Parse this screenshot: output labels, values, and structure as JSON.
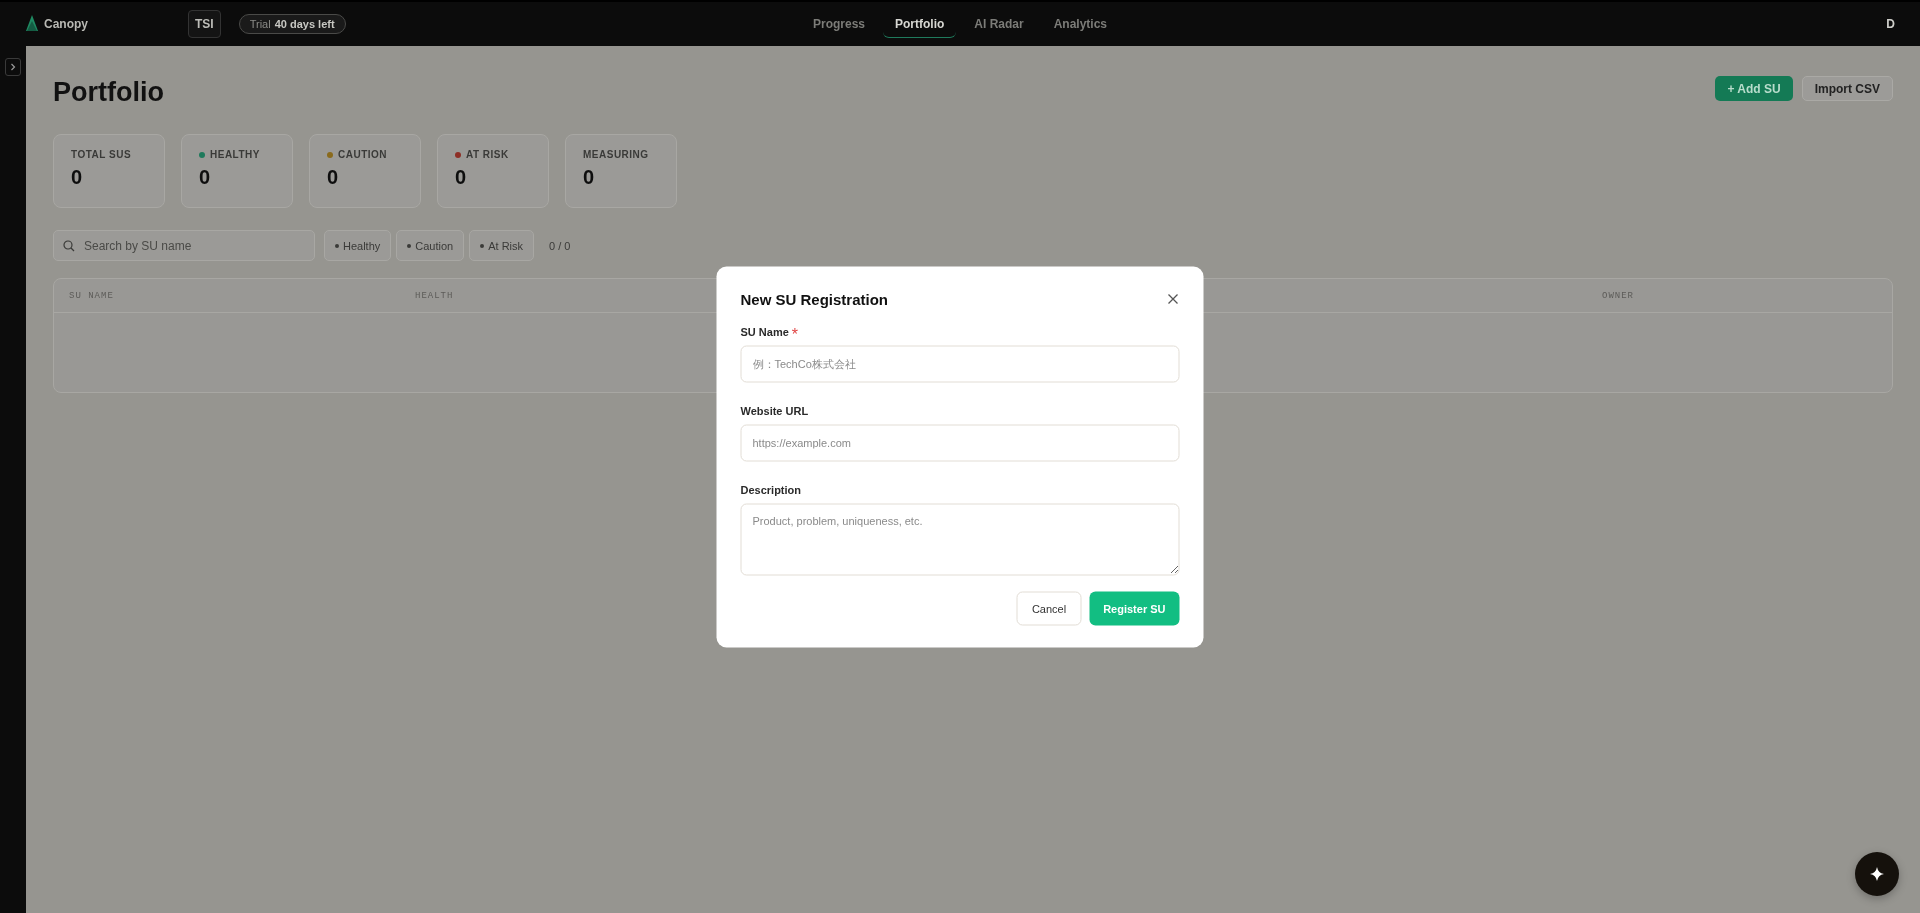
{
  "topbar": {
    "brand": "Canopy",
    "workspace": "TSI",
    "trial": {
      "label": "Trial",
      "value": "40 days left"
    },
    "nav": [
      {
        "label": "Progress",
        "selected": false
      },
      {
        "label": "Portfolio",
        "selected": true
      },
      {
        "label": "AI Radar",
        "selected": false
      },
      {
        "label": "Analytics",
        "selected": false
      }
    ],
    "user": "D"
  },
  "page": {
    "title": "Portfolio",
    "actions": [
      {
        "label": "+ Add SU",
        "kind": "primary"
      },
      {
        "label": "Import CSV",
        "kind": "secondary"
      }
    ],
    "stats": [
      {
        "label": "TOTAL SUS",
        "value": "0"
      },
      {
        "label": "HEALTHY",
        "value": "0",
        "color": "#1f7a5c"
      },
      {
        "label": "CAUTION",
        "value": "0",
        "color": "#8a6a1c"
      },
      {
        "label": "AT RISK",
        "value": "0",
        "color": "#8e2f26"
      },
      {
        "label": "MEASURING",
        "value": "0"
      }
    ],
    "search": {
      "placeholder": "Search by SU name"
    },
    "filters": [
      {
        "label": "Healthy"
      },
      {
        "label": "Caution"
      },
      {
        "label": "At Risk"
      }
    ],
    "count": "0 / 0",
    "table": {
      "columns": [
        "SU NAME",
        "HEALTH",
        "OWNER"
      ]
    }
  },
  "modal": {
    "title": "New SU Registration",
    "fields": [
      {
        "label": "SU Name",
        "marker": "*",
        "placeholder": "例：TechCo株式会社",
        "kind": "input"
      },
      {
        "label": "Website URL",
        "placeholder": "https://example.com",
        "kind": "input"
      },
      {
        "label": "Description",
        "placeholder": "Product, problem, uniqueness, etc.",
        "kind": "textarea"
      }
    ],
    "buttons": [
      {
        "label": "Cancel",
        "kind": "secondary"
      },
      {
        "label": "Register SU",
        "kind": "primary"
      }
    ]
  }
}
